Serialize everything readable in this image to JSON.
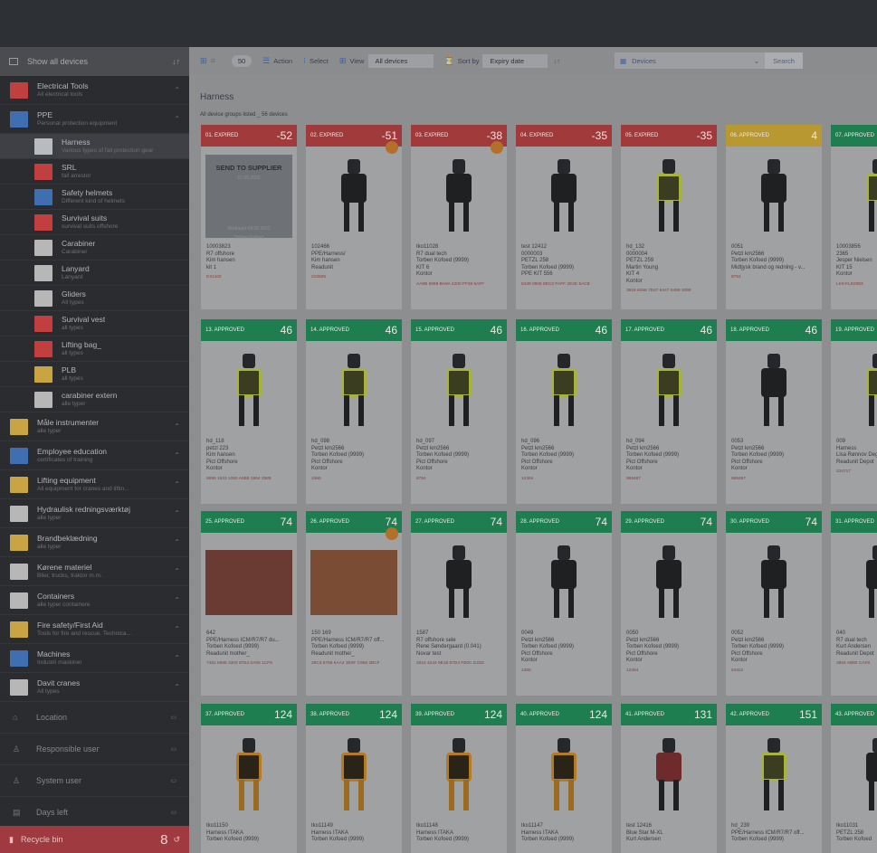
{
  "sidebar": {
    "header_label": "Show all devices",
    "categories": [
      {
        "title": "Electrical Tools",
        "subtitle": "All electrical tools"
      },
      {
        "title": "PPE",
        "subtitle": "Personal protection equipment"
      }
    ],
    "ppe_items": [
      {
        "title": "Harness",
        "subtitle": "Various types of fall protection gear"
      },
      {
        "title": "SRL",
        "subtitle": "fall arrestor"
      },
      {
        "title": "Safety helmets",
        "subtitle": "Different kind of helmets"
      },
      {
        "title": "Survival suits",
        "subtitle": "survival suits offshore"
      },
      {
        "title": "Carabiner",
        "subtitle": "Carabiner"
      },
      {
        "title": "Lanyard",
        "subtitle": "Lanyard"
      },
      {
        "title": "Gliders",
        "subtitle": "All types"
      },
      {
        "title": "Survival vest",
        "subtitle": "all types"
      },
      {
        "title": "Lifting bag_",
        "subtitle": "all types"
      },
      {
        "title": "PLB",
        "subtitle": "all types"
      },
      {
        "title": "carabiner extern",
        "subtitle": "alle typer"
      }
    ],
    "more_categories": [
      {
        "title": "Måle instrumenter",
        "subtitle": "alle typer"
      },
      {
        "title": "Employee education",
        "subtitle": "certificates of training"
      },
      {
        "title": "Lifting equipment",
        "subtitle": "All equipment for cranes and liftin..."
      },
      {
        "title": "Hydraulisk redningsværktøj",
        "subtitle": "alle typer"
      },
      {
        "title": "Brandbeklædning",
        "subtitle": "alle typer"
      },
      {
        "title": "Kørene materiel",
        "subtitle": "Biler, trucks, traktor m.m."
      },
      {
        "title": "Containers",
        "subtitle": "alle typer containere"
      },
      {
        "title": "Fire safety/First Aid",
        "subtitle": "Tools for fire and rescue. Technica..."
      },
      {
        "title": "Machines",
        "subtitle": "Industri maskiner"
      },
      {
        "title": "Davit cranes",
        "subtitle": "All types"
      }
    ],
    "filters": [
      "Location",
      "Responsible user",
      "System user",
      "Days left"
    ],
    "recycle": {
      "label": "Recycle bin",
      "count": "8"
    }
  },
  "toolbar": {
    "page_size": "50",
    "action": "Action",
    "select": "Select",
    "view": "View",
    "view_value": "All devices",
    "sort_by": "Sort by",
    "sort_value": "Expiry date",
    "search_placeholder": "Devices",
    "search_button": "Search"
  },
  "breadcrumb": "Harness",
  "counts": "All device groups listed  _ 56 devices",
  "cards_row1": [
    {
      "status": "01. EXPIRED",
      "days": "-52",
      "l1": "10003823",
      "l2": "R7 offshore",
      "l3": "Kim hansen",
      "l4": "kit 1",
      "code": "EX1102",
      "supplier": {
        "title": "SEND TO SUPPLIER",
        "date": "17.05.2022",
        "note": "Modtaget 04.05.2022",
        "by": "Torben Kofoed"
      }
    },
    {
      "status": "02. EXPIRED",
      "days": "-51",
      "l1": "102466",
      "l2": "PPE/Harness/",
      "l3": "Kim hansen",
      "l4": "Readunit",
      "code": "210505"
    },
    {
      "status": "03. EXPIRED",
      "days": "-38",
      "l1": "tko11028",
      "l2": "R7 dual tech",
      "l3": "Torben Kofoed (9999)",
      "l4": "KIT 6",
      "l5": "Kontor",
      "code": "AA8B 5999 BA9A 4200 FF38 5AFF"
    },
    {
      "status": "04. EXPIRED",
      "days": "-35",
      "l1": "test 12412",
      "l2": "0000003",
      "l3": "PETZL 258",
      "l4": "Torben Kofoed (9999)",
      "l5": "PPE KIT 556",
      "code": "8439 0905 8EC0 FAFF 2E2E 5ACE"
    },
    {
      "status": "05. EXPIRED",
      "days": "-35",
      "l1": "hd_132",
      "l2": "0000004",
      "l3": "PETZL 259",
      "l4": "Martin Young",
      "l5": "KIT 4",
      "l6": "Kontor",
      "code": "3918 8258 7D47 8447 6498 3098"
    },
    {
      "status": "06. APPROVED",
      "days": "4",
      "l1": "0051",
      "l2": "Petzl km2566",
      "l3": "Torben Kofoed (9999)",
      "l4": "Midtjysk brand og redning - v...",
      "code": "8754"
    },
    {
      "status": "07. APPROVED",
      "days": "",
      "l1": "10003856",
      "l2": "2365",
      "l3": "Jesper Nielsen",
      "l4": "KIT 15",
      "l5": "Kontor",
      "code": "LK0-FLK0083"
    }
  ],
  "cards_row2": [
    {
      "status": "13. APPROVED",
      "days": "46",
      "l1": "hd_118",
      "l2": "petzl 223",
      "l3": "Kim hansen",
      "l4": "Pict Offshore",
      "l5": "Kontor",
      "code": "5996 1533 1060 A6B8 1864 2589"
    },
    {
      "status": "14. APPROVED",
      "days": "46",
      "l1": "hd_098",
      "l2": "Petzl km2566",
      "l3": "Torben Kofoed (9999)",
      "l4": "Pict Offshore",
      "l5": "Kontor",
      "code": "2365"
    },
    {
      "status": "15. APPROVED",
      "days": "46",
      "l1": "hd_097",
      "l2": "Petzl km2566",
      "l3": "Torben Kofoed (9999)",
      "l4": "Pict Offshore",
      "l5": "Kontor",
      "code": "8754"
    },
    {
      "status": "16. APPROVED",
      "days": "46",
      "l1": "hd_096",
      "l2": "Petzl km2566",
      "l3": "Torben Kofoed (9999)",
      "l4": "Pict Offshore",
      "l5": "Kontor",
      "code": "12364"
    },
    {
      "status": "17. APPROVED",
      "days": "46",
      "l1": "hd_094",
      "l2": "Petzl km2566",
      "l3": "Torben Kofoed (9999)",
      "l4": "Pict Offshore",
      "l5": "Kontor",
      "code": "965487"
    },
    {
      "status": "18. APPROVED",
      "days": "46",
      "l1": "0053",
      "l2": "Petzl km2566",
      "l3": "Torben Kofoed (9999)",
      "l4": "Pict Offshore",
      "l5": "Kontor",
      "code": "965487"
    },
    {
      "status": "19. APPROVED",
      "days": "",
      "l1": "009",
      "l2": "Harness",
      "l3": "Lisa Rønnov Degn",
      "l4": "Readunit Depot",
      "code": "234717"
    }
  ],
  "cards_row3": [
    {
      "status": "25. APPROVED",
      "days": "74",
      "l1": "642",
      "l2": "PPE/Harness ICM/R7/R7 du...",
      "l3": "Torben Kofoed (9999)",
      "l4": "Readunit mother_",
      "code": "7481 8588 3302 87E4 0A06 1CF8"
    },
    {
      "status": "26. APPROVED",
      "days": "74",
      "l1": "150 169",
      "l2": "PPE/Harness ICM/R7/R7 off...",
      "l3": "Torben Kofoed (9999)",
      "l4": "Readunit mother_",
      "code": "29C3 6766 5AA4 3E0F C955 2BCF"
    },
    {
      "status": "27. APPROVED",
      "days": "74",
      "l1": "1587",
      "l2": "R7 offshore sele",
      "l3": "Rene Søndergaard (0.041)",
      "l4": "Novar test",
      "code": "2816 4244 9E18 87D4 FB0C E33D"
    },
    {
      "status": "28. APPROVED",
      "days": "74",
      "l1": "0049",
      "l2": "Petzl km2566",
      "l3": "Torben Kofoed (9999)",
      "l4": "Pict Offshore",
      "l5": "Kontor",
      "code": "2365"
    },
    {
      "status": "29. APPROVED",
      "days": "74",
      "l1": "0050",
      "l2": "Petzl km2566",
      "l3": "Torben Kofoed (9999)",
      "l4": "Pict Offshore",
      "l5": "Kontor",
      "code": "12364"
    },
    {
      "status": "30. APPROVED",
      "days": "74",
      "l1": "0052",
      "l2": "Petzl km2566",
      "l3": "Torben Kofoed (9999)",
      "l4": "Pict Offshore",
      "l5": "Kontor",
      "code": "54321"
    },
    {
      "status": "31. APPROVED",
      "days": "",
      "l1": "040",
      "l2": "R7 dual tech",
      "l3": "Kurt Andersen",
      "l4": "Readunit Depot",
      "code": "3864 AB80 CAF8"
    }
  ],
  "cards_row4": [
    {
      "status": "37. APPROVED",
      "days": "124",
      "l1": "tko11150",
      "l2": "Harness ITAKA",
      "l3": "Torben Kofoed (9999)"
    },
    {
      "status": "38. APPROVED",
      "days": "124",
      "l1": "tko11149",
      "l2": "Harness ITAKA",
      "l3": "Torben Kofoed (9999)"
    },
    {
      "status": "39. APPROVED",
      "days": "124",
      "l1": "tko11148",
      "l2": "Harness ITAKA",
      "l3": "Torben Kofoed (9999)"
    },
    {
      "status": "40. APPROVED",
      "days": "124",
      "l1": "tko11147",
      "l2": "Harness ITAKA",
      "l3": "Torben Kofoed (9999)"
    },
    {
      "status": "41. APPROVED",
      "days": "131",
      "l1": "test 12416",
      "l2": "Blue Star M-XL",
      "l3": "Kurt Andersen"
    },
    {
      "status": "42. APPROVED",
      "days": "151",
      "l1": "hd_239",
      "l2": "PPE/Harness ICM/R7/R7 off...",
      "l3": "Torben Kofoed (9999)"
    },
    {
      "status": "43. APPROVED",
      "days": "",
      "l1": "tko11031",
      "l2": "PETZL 258",
      "l3": "Torben Kofoed"
    }
  ]
}
